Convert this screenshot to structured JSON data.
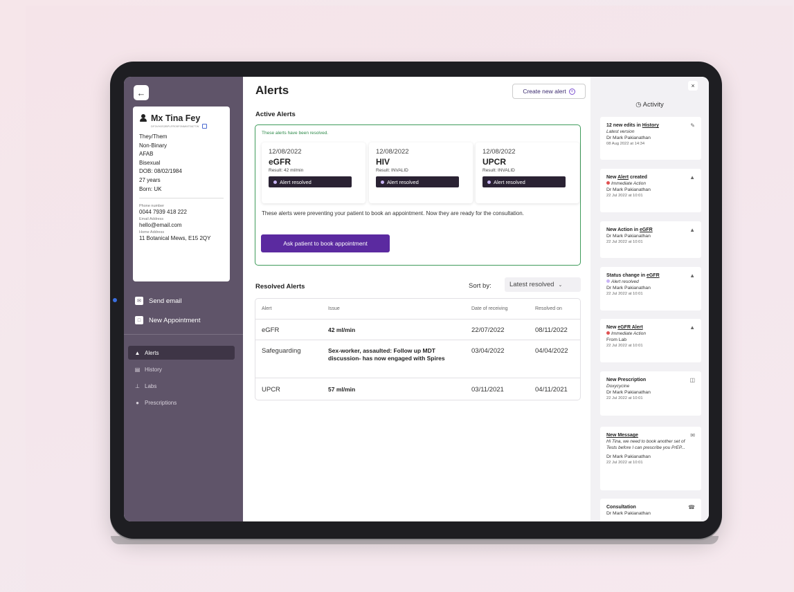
{
  "patient": {
    "name": "Mx Tina Fey",
    "id": "DF3VH0S2BPLFR05F0NMMT5677W",
    "pronouns": "They/Them",
    "gender": "Non-Binary",
    "sex": "AFAB",
    "orientation": "Bisexual",
    "dob": "DOB: 08/02/1984",
    "age": "27 years",
    "born": "Born: UK",
    "phone_label": "Phone number",
    "phone": "0044 7939 418 222",
    "email_label": "Email Address",
    "email": "hello@email.com",
    "address_label": "Home Address",
    "address": "11 Botanical Mews, E15 2QY"
  },
  "sidebar": {
    "actions": [
      {
        "label": "Send email",
        "icon": "mail-icon"
      },
      {
        "label": "New Appointment",
        "icon": "calendar-icon"
      }
    ],
    "nav": [
      {
        "label": "Alerts",
        "icon": "bell-icon",
        "active": true
      },
      {
        "label": "History",
        "icon": "history-icon",
        "active": false
      },
      {
        "label": "Labs",
        "icon": "flask-icon",
        "active": false
      },
      {
        "label": "Prescriptions",
        "icon": "pill-icon",
        "active": false
      }
    ]
  },
  "main": {
    "title": "Alerts",
    "create_button": "Create new alert",
    "active_title": "Active Alerts",
    "resolved_note": "These alerts have been resolved.",
    "alert_cards": [
      {
        "date": "12/08/2022",
        "test": "eGFR",
        "result": "Result: 42 ml/min",
        "badge": "Alert resolved"
      },
      {
        "date": "12/08/2022",
        "test": "HIV",
        "result": "Result: INVALID",
        "badge": "Alert resolved"
      },
      {
        "date": "12/08/2022",
        "test": "UPCR",
        "result": "Result: INVALID",
        "badge": "Alert resolved"
      }
    ],
    "active_message": "These alerts were preventing your patient to book an appointment. Now they are ready for the consultation.",
    "ask_button": "Ask patient to book appointment",
    "resolved_title": "Resolved Alerts",
    "sort_label": "Sort by:",
    "sort_value": "Latest resolved",
    "table": {
      "headers": [
        "Alert",
        "Issue",
        "Date of receiving",
        "Resolved on"
      ],
      "rows": [
        {
          "alert": "eGFR",
          "issue": "42 ml/min",
          "received": "22/07/2022",
          "resolved": "08/11/2022"
        },
        {
          "alert": "Safeguarding",
          "issue": "Sex-worker, assaulted: Follow up MDT discussion- has now engaged with Spires",
          "received": "03/04/2022",
          "resolved": "04/04/2022"
        },
        {
          "alert": "UPCR",
          "issue": "57 ml/min",
          "received": "03/11/2021",
          "resolved": "04/11/2021"
        }
      ]
    }
  },
  "activity": {
    "title": "Activity",
    "items": [
      {
        "pre": "12 new edits in ",
        "link": "History",
        "post": "",
        "sub": "Latest version",
        "by": "Dr Mark Pakianathan",
        "time": "08 Aug 2022 at 14:34",
        "icon": "pencil-icon"
      },
      {
        "pre": "New ",
        "link": "Alert",
        "post": " created",
        "status": "Immediate Action",
        "status_color": "#e05252",
        "by": "Dr Mark Pakianathan",
        "time": "22 Jul 2022 at 10:01",
        "icon": "bell-icon"
      },
      {
        "pre": "New Action in ",
        "link": "eGFR",
        "post": "",
        "by": "Dr Mark Pakianathan",
        "time": "22 Jul 2022 at 10:01",
        "icon": "bell-icon"
      },
      {
        "pre": "Status change in ",
        "link": "eGFR",
        "post": "",
        "status": "Alert resolved",
        "status_color": "#c9b5f5",
        "by": "Dr Mark Pakianathan",
        "time": "22 Jul 2022 at 10:01",
        "icon": "bell-icon"
      },
      {
        "pre": "New ",
        "link": "eGFR Alert",
        "post": "",
        "status": "Immediate Action",
        "status_color": "#e05252",
        "by": "From Lab",
        "time": "22 Jul 2022 at 10:01",
        "icon": "bell-icon"
      },
      {
        "pre": "New Prescription",
        "link": "",
        "post": "",
        "sub": "Doxycycine",
        "by": "Dr Mark Pakianathan",
        "time": "22 Jul 2022 at 10:01",
        "icon": "pill-bottle-icon"
      },
      {
        "pre": "",
        "link": "New Message",
        "post": "",
        "sub": "Hi Tina, we need to book another set of Tests before I can prescribe you PrEP...",
        "by": "Dr Mark Pakianathan",
        "time": "22 Jul 2022 at 10:01",
        "icon": "mail-icon"
      },
      {
        "pre": "Consultation",
        "link": "",
        "post": "",
        "by": "Dr Mark Pakianathan",
        "time": "",
        "icon": "phone-icon"
      }
    ]
  }
}
